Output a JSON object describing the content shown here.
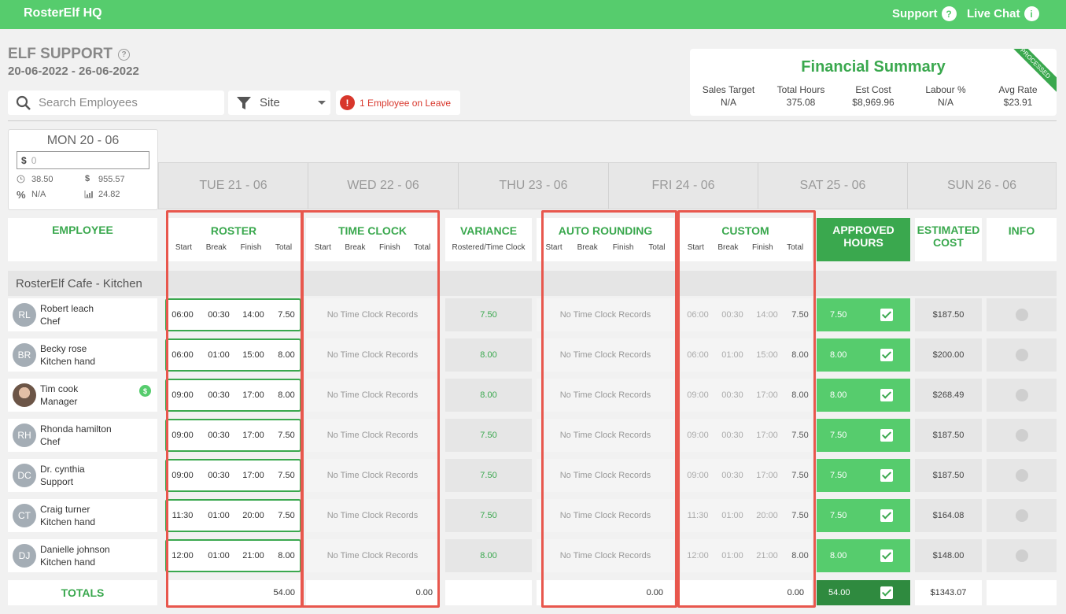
{
  "app": {
    "brand": "RosterElf HQ",
    "support": "Support",
    "support_icon": "?",
    "live_chat": "Live Chat",
    "live_chat_icon": "i"
  },
  "org": {
    "name": "ELF SUPPORT",
    "help_icon": "?",
    "date_range": "20-06-2022 - 26-06-2022"
  },
  "search": {
    "placeholder": "Search Employees"
  },
  "site": {
    "label": "Site"
  },
  "leave": {
    "icon": "!",
    "text": "1 Employee on Leave"
  },
  "financial": {
    "title": "Financial Summary",
    "status": "PROCESSED",
    "cols": [
      {
        "label": "Sales Target",
        "value": "N/A"
      },
      {
        "label": "Total Hours",
        "value": "375.08"
      },
      {
        "label": "Est Cost",
        "value": "$8,969.96"
      },
      {
        "label": "Labour %",
        "value": "N/A"
      },
      {
        "label": "Avg Rate",
        "value": "$23.91"
      }
    ]
  },
  "monday": {
    "title": "MON 20 - 06",
    "currency": "$",
    "input_placeholder": "0",
    "hours": "38.50",
    "cost_sym": "$",
    "cost": "955.57",
    "pct_sym": "%",
    "pct": "N/A",
    "rate": "24.82"
  },
  "days": [
    "TUE 21 - 06",
    "WED 22 - 06",
    "THU 23 - 06",
    "FRI 24 - 06",
    "SAT 25 - 06",
    "SUN 26 - 06"
  ],
  "headers": {
    "employee": "EMPLOYEE",
    "roster": "ROSTER",
    "time_clock": "TIME CLOCK",
    "variance": "VARIANCE",
    "variance_sub": "Rostered/Time Clock",
    "auto_rounding": "AUTO ROUNDING",
    "custom": "CUSTOM",
    "approved_line1": "APPROVED",
    "approved_line2": "HOURS",
    "est_line1": "ESTIMATED",
    "est_line2": "COST",
    "info": "INFO",
    "sub": [
      "Start",
      "Break",
      "Finish",
      "Total"
    ]
  },
  "group": "RosterElf Cafe - Kitchen",
  "no_records": "No Time Clock Records",
  "employees": [
    {
      "initials": "RL",
      "name": "Robert leach",
      "role": "Chef",
      "start": "06:00",
      "brk": "00:30",
      "finish": "14:00",
      "total": "7.50",
      "variance": "7.50",
      "approved": "7.50",
      "cost": "$187.50"
    },
    {
      "initials": "BR",
      "name": "Becky rose",
      "role": "Kitchen hand",
      "start": "06:00",
      "brk": "01:00",
      "finish": "15:00",
      "total": "8.00",
      "variance": "8.00",
      "approved": "8.00",
      "cost": "$200.00"
    },
    {
      "initials": "TC",
      "name": "Tim cook",
      "role": "Manager",
      "start": "09:00",
      "brk": "00:30",
      "finish": "17:00",
      "total": "8.00",
      "variance": "8.00",
      "approved": "8.00",
      "cost": "$268.49",
      "badge": "$"
    },
    {
      "initials": "RH",
      "name": "Rhonda hamilton",
      "role": "Chef",
      "start": "09:00",
      "brk": "00:30",
      "finish": "17:00",
      "total": "7.50",
      "variance": "7.50",
      "approved": "7.50",
      "cost": "$187.50"
    },
    {
      "initials": "DC",
      "name": "Dr. cynthia",
      "role": "Support",
      "start": "09:00",
      "brk": "00:30",
      "finish": "17:00",
      "total": "7.50",
      "variance": "7.50",
      "approved": "7.50",
      "cost": "$187.50"
    },
    {
      "initials": "CT",
      "name": "Craig turner",
      "role": "Kitchen hand",
      "start": "11:30",
      "brk": "01:00",
      "finish": "20:00",
      "total": "7.50",
      "variance": "7.50",
      "approved": "7.50",
      "cost": "$164.08"
    },
    {
      "initials": "DJ",
      "name": "Danielle johnson",
      "role": "Kitchen hand",
      "start": "12:00",
      "brk": "01:00",
      "finish": "21:00",
      "total": "8.00",
      "variance": "8.00",
      "approved": "8.00",
      "cost": "$148.00"
    }
  ],
  "totals": {
    "label": "TOTALS",
    "roster": "54.00",
    "time_clock": "0.00",
    "auto_rounding": "0.00",
    "custom": "0.00",
    "approved": "54.00",
    "cost": "$1343.07"
  }
}
